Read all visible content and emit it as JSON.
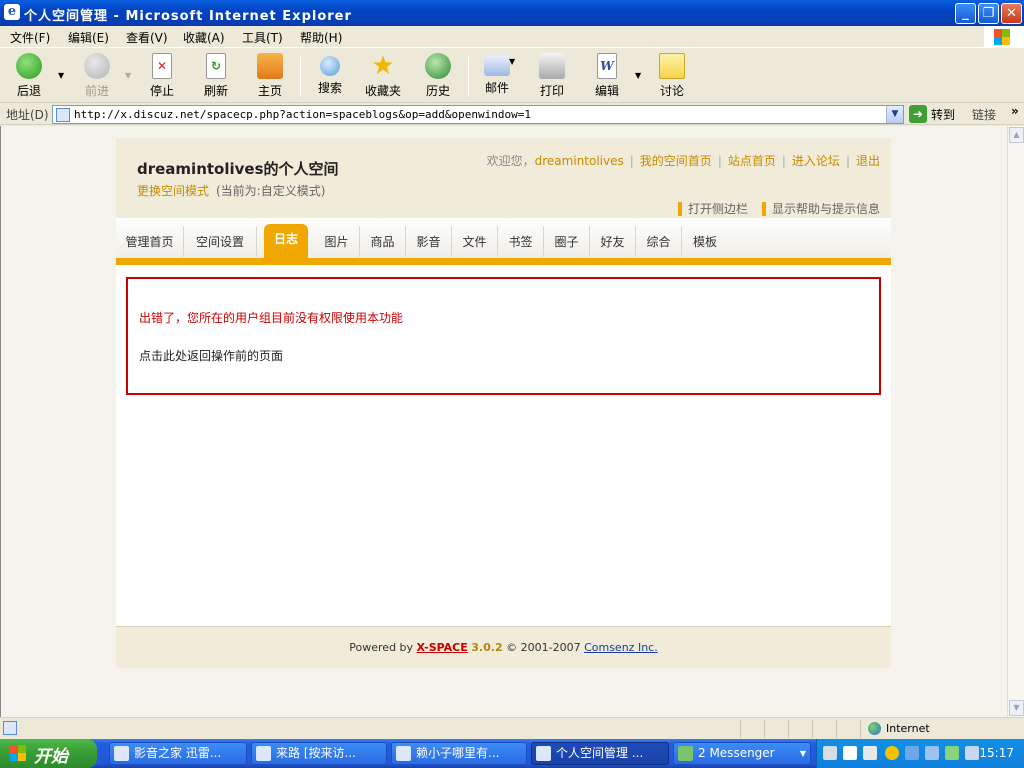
{
  "window": {
    "title": "个人空间管理 - Microsoft Internet Explorer",
    "minimize": "_",
    "restore": "❐",
    "close": "✕"
  },
  "menu": [
    "文件(F)",
    "编辑(E)",
    "查看(V)",
    "收藏(A)",
    "工具(T)",
    "帮助(H)"
  ],
  "toolbar": {
    "back": "后退",
    "forward": "前进",
    "stop": "停止",
    "refresh": "刷新",
    "home": "主页",
    "search": "搜索",
    "favorites": "收藏夹",
    "history": "历史",
    "mail": "邮件",
    "print": "打印",
    "edit": "编辑",
    "discuss": "讨论"
  },
  "address": {
    "label": "地址(D)",
    "url": "http://x.discuz.net/spacecp.php?action=spaceblogs&op=add&openwindow=1",
    "go": "转到",
    "links": "链接"
  },
  "space": {
    "name": "dreamintolives的个人空间",
    "mode_link": "更换空间模式",
    "mode_note": "(当前为:自定义模式)",
    "welcome": "欢迎您，",
    "username": "dreamintolives",
    "nav": [
      "我的空间首页",
      "站点首页",
      "进入论坛",
      "退出"
    ],
    "tips": [
      "打开侧边栏",
      "显示帮助与提示信息"
    ]
  },
  "tabs": [
    "管理首页",
    "空间设置",
    "日志",
    "图片",
    "商品",
    "影音",
    "文件",
    "书签",
    "圈子",
    "好友",
    "综合",
    "模板"
  ],
  "active_tab": "日志",
  "error": {
    "message": "出错了，您所在的用户组目前没有权限使用本功能",
    "back": "点击此处返回操作前的页面"
  },
  "footer": {
    "powered": "Powered by",
    "product": "X-SPACE",
    "version": "3.0.2",
    "copyright": "© 2001-2007",
    "company": "Comsenz Inc."
  },
  "status": {
    "zone": "Internet"
  },
  "taskbar": {
    "start": "开始",
    "tasks": [
      "影音之家 迅雷...",
      "来路 [按来访...",
      "赖小子哪里有...",
      "个人空间管理 ...",
      "2 Messenger"
    ],
    "clock": "15:17"
  },
  "colors": {
    "accent": "#F0A800",
    "link": "#C88A00",
    "error": "#CC0000"
  }
}
